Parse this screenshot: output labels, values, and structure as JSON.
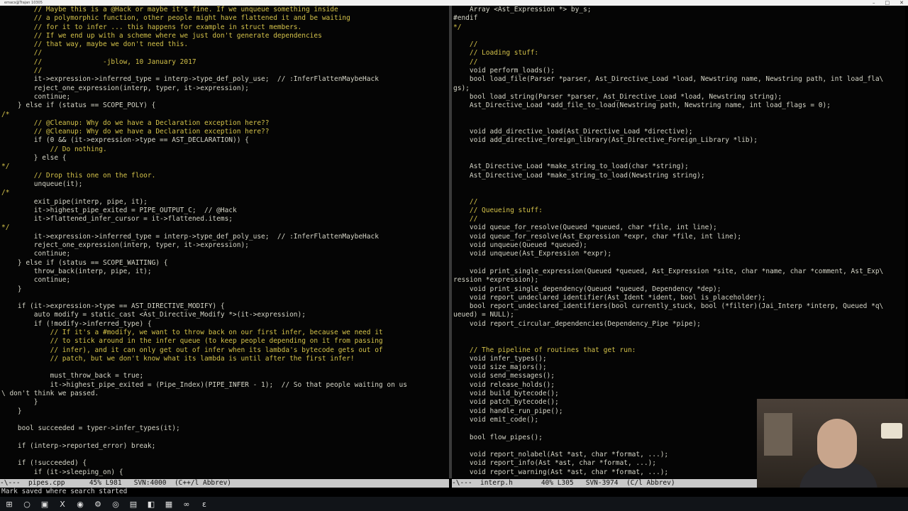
{
  "window": {
    "title": "emacs@Trajan 10305"
  },
  "left_pane": {
    "lines": [
      "        // Maybe this is a @Hack or maybe it's fine. If we unqueue something inside",
      "        // a polymorphic function, other people might have flattened it and be waiting",
      "        // for it to infer ... this happens for example in struct members.",
      "        // If we end up with a scheme where we just don't generate dependencies",
      "        // that way, maybe we don't need this.",
      "        //",
      "        //               -jblow, 10 January 2017",
      "        //",
      "        it->expression->inferred_type = interp->type_def_poly_use;  // :InferFlattenMaybeHack",
      "        reject_one_expression(interp, typer, it->expression);",
      "        continue;",
      "    } else if (status == SCOPE_POLY) {",
      "/*",
      "        // @Cleanup: Why do we have a Declaration exception here??",
      "        // @Cleanup: Why do we have a Declaration exception here??",
      "        if (0 && (it->expression->type == AST_DECLARATION)) {",
      "            // Do nothing.",
      "        } else {",
      "*/",
      "        // Drop this one on the floor.",
      "        unqueue(it);",
      "/*",
      "        exit_pipe(interp, pipe, it);",
      "        it->highest_pipe_exited = PIPE_OUTPUT_C;  // @Hack",
      "        it->flattened_infer_cursor = it->flattened.items;",
      "*/",
      "        it->expression->inferred_type = interp->type_def_poly_use;  // :InferFlattenMaybeHack",
      "        reject_one_expression(interp, typer, it->expression);",
      "        continue;",
      "    } else if (status == SCOPE_WAITING) {",
      "        throw_back(interp, pipe, it);",
      "        continue;",
      "    }",
      "",
      "    if (it->expression->type == AST_DIRECTIVE_MODIFY) {",
      "        auto modify = static_cast <Ast_Directive_Modify *>(it->expression);",
      "        if (!modify->inferred_type) {",
      "            // If it's a #modify, we want to throw back on our first infer, because we need it",
      "            // to stick around in the infer queue (to keep people depending on it from passing",
      "            // infer), and it can only get out of infer when its lambda's bytecode gets out of",
      "            // patch, but we don't know what its lambda is until after the first infer!",
      "",
      "            must_throw_back = true;",
      "            it->highest_pipe_exited = (Pipe_Index)(PIPE_INFER - 1);  // So that people waiting on us",
      "\\ don't think we passed.",
      "        }",
      "    }",
      "",
      "    bool succeeded = typer->infer_types(it);",
      "",
      "    if (interp->reported_error) break;",
      "",
      "    if (!succeeded) {",
      "        if (it->sleeping_on) {"
    ]
  },
  "right_pane": {
    "lines": [
      "    Array <Ast_Expression *> by_s;",
      "#endif",
      "*/",
      "",
      "    //",
      "    // Loading stuff:",
      "    //",
      "    void perform_loads();",
      "    bool load_file(Parser *parser, Ast_Directive_Load *load, Newstring name, Newstring path, int load_fla\\",
      "gs);",
      "    bool load_string(Parser *parser, Ast_Directive_Load *load, Newstring string);",
      "    Ast_Directive_Load *add_file_to_load(Newstring path, Newstring name, int load_flags = 0);",
      "",
      "",
      "    void add_directive_load(Ast_Directive_Load *directive);",
      "    void add_directive_foreign_library(Ast_Directive_Foreign_Library *lib);",
      "",
      "",
      "    Ast_Directive_Load *make_string_to_load(char *string);",
      "    Ast_Directive_Load *make_string_to_load(Newstring string);",
      "",
      "",
      "    //",
      "    // Queueing stuff:",
      "    //",
      "    void queue_for_resolve(Queued *queued, char *file, int line);",
      "    void queue_for_resolve(Ast_Expression *expr, char *file, int line);",
      "    void unqueue(Queued *queued);",
      "    void unqueue(Ast_Expression *expr);",
      "",
      "    void print_single_expression(Queued *queued, Ast_Expression *site, char *name, char *comment, Ast_Exp\\",
      "ression *expression);",
      "    void print_single_dependency(Queued *queued, Dependency *dep);",
      "    void report_undeclared_identifier(Ast_Ident *ident, bool is_placeholder);",
      "    bool report_undeclared_identifiers(bool currently_stuck, bool (*filter)(Jai_Interp *interp, Queued *q\\",
      "ueued) = NULL);",
      "    void report_circular_dependencies(Dependency_Pipe *pipe);",
      "",
      "",
      "    // The pipeline of routines that get run:",
      "    void infer_types();",
      "    void size_majors();",
      "    void send_messages();",
      "    void release_holds();",
      "    void build_bytecode();",
      "    void patch_bytecode();",
      "    void handle_run_pipe();",
      "    void emit_code();",
      "",
      "    bool flow_pipes();",
      "",
      "    void report_nolabel(Ast *ast, char *format, ...);",
      "    void report_info(Ast *ast, char *format, ...);",
      "    void report_warning(Ast *ast, char *format, ...);"
    ]
  },
  "modeline_left": "-\\---  pipes.cpp      45% L981   SVN:4000  (C++/l Abbrev)",
  "modeline_right": "-\\---  interp.h       40% L305   SVN-3974  (C/l Abbrev)",
  "minibuffer": "Mark saved where search started",
  "taskbar_icons": [
    "windows-start-icon",
    "search-icon",
    "file-explorer-icon",
    "excel-icon",
    "chrome-icon",
    "settings-icon",
    "chrome-alt-icon",
    "terminal-icon",
    "app-icon",
    "spreadsheet-icon",
    "visual-studio-icon",
    "emacs-icon"
  ],
  "colors": {
    "comment": "#d4c24a",
    "keyword": "#e8e8e8",
    "default": "#d6d6c8",
    "background": "#050505",
    "modeline": "#c9c9c9"
  }
}
